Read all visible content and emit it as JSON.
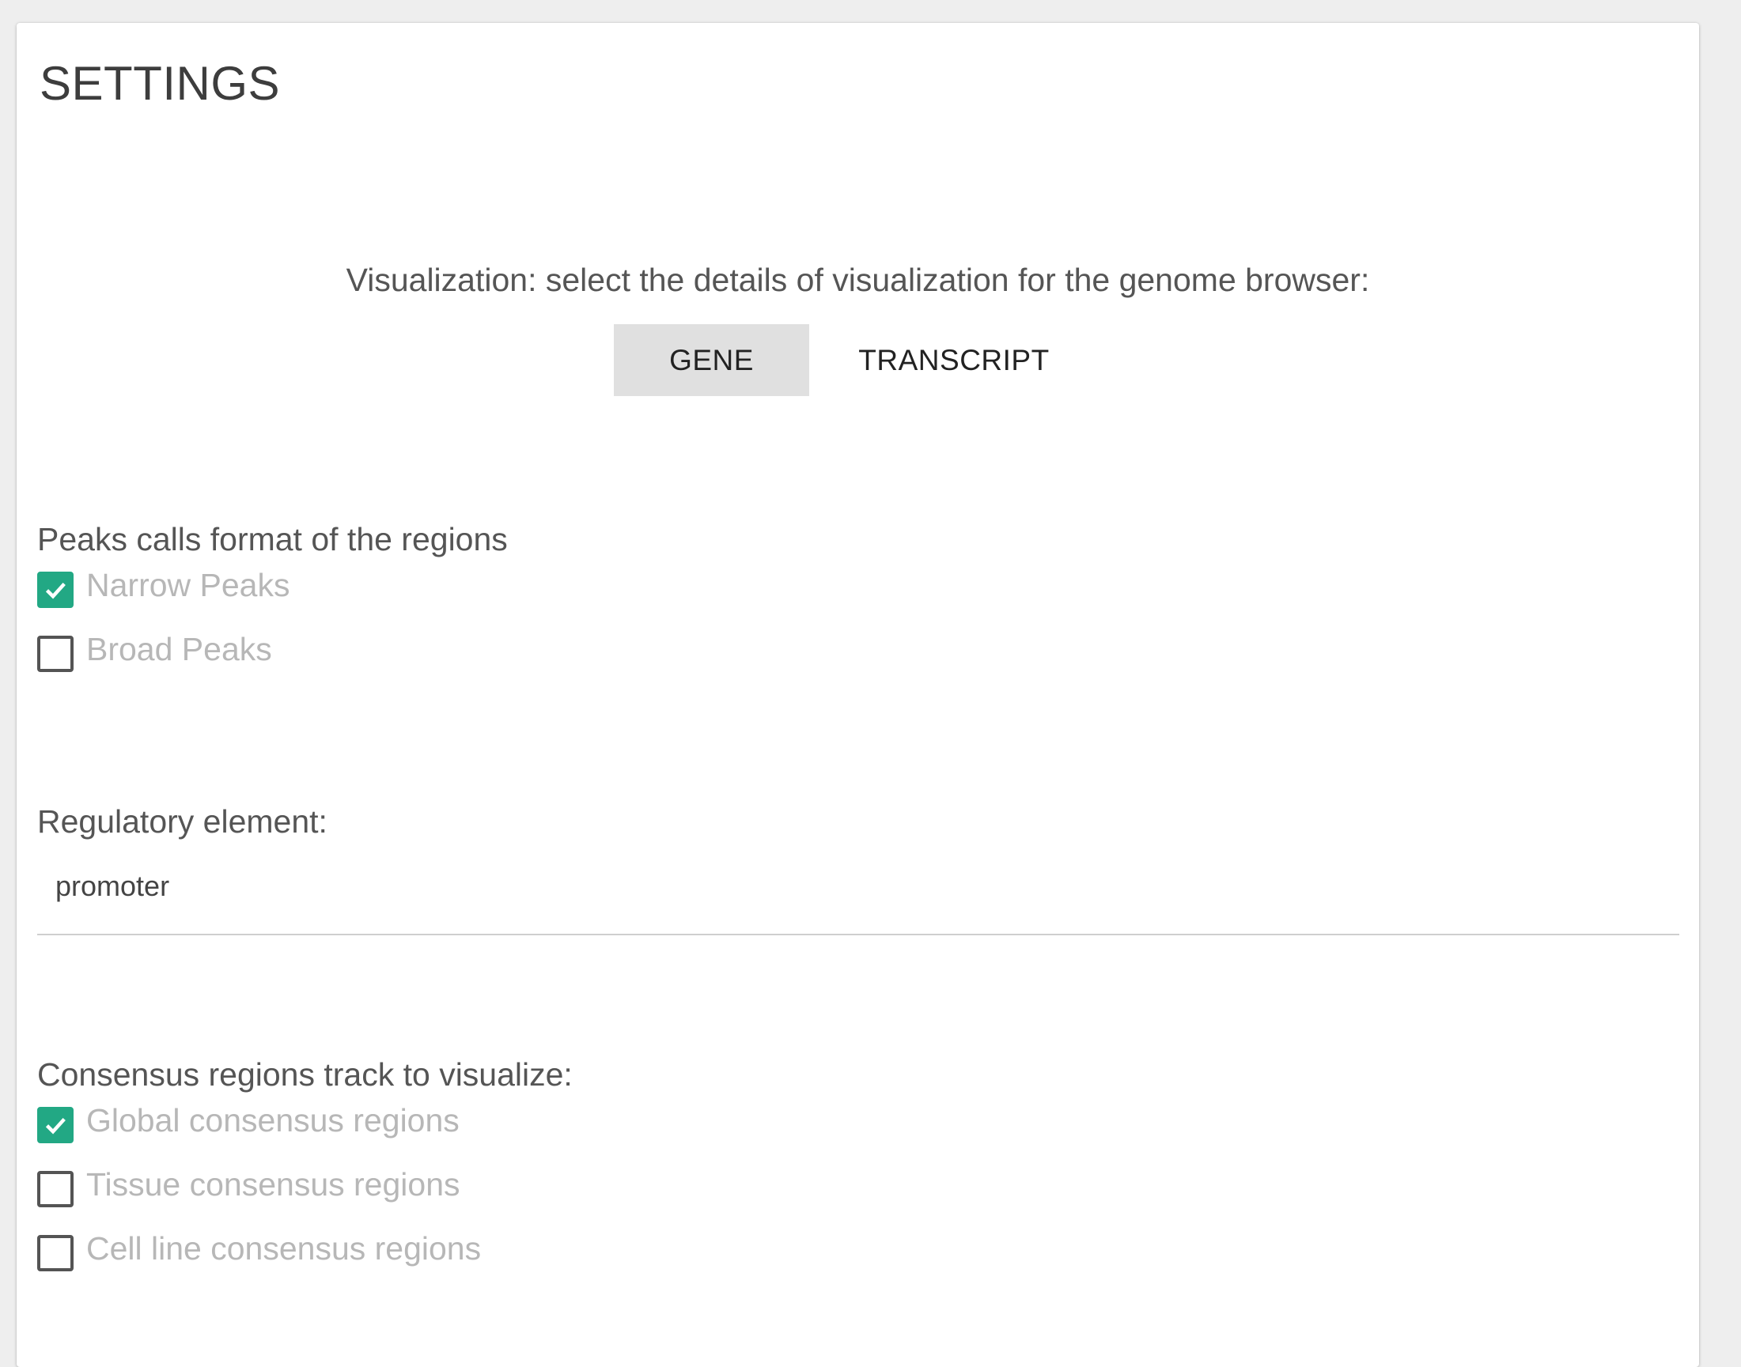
{
  "page": {
    "title": "SETTINGS"
  },
  "visualization": {
    "label": "Visualization: select the details of visualization for the genome browser:",
    "options": [
      {
        "label": "GENE",
        "selected": true
      },
      {
        "label": "TRANSCRIPT",
        "selected": false
      }
    ]
  },
  "peaks": {
    "label": "Peaks calls format of the regions",
    "options": [
      {
        "label": "Narrow Peaks",
        "checked": true
      },
      {
        "label": "Broad Peaks",
        "checked": false
      }
    ]
  },
  "regulatory": {
    "label": "Regulatory element:",
    "value": "promoter"
  },
  "consensus": {
    "label": "Consensus regions track to visualize:",
    "options": [
      {
        "label": "Global consensus regions",
        "checked": true
      },
      {
        "label": "Tissue consensus regions",
        "checked": false
      },
      {
        "label": "Cell line consensus regions",
        "checked": false
      }
    ]
  },
  "colors": {
    "accent": "#22a884",
    "selected_toggle_bg": "#e0e0e0",
    "page_bg": "#eeeeee",
    "disabled_text": "#b7b7b7"
  },
  "icons": {
    "checkmark": "check-icon"
  }
}
